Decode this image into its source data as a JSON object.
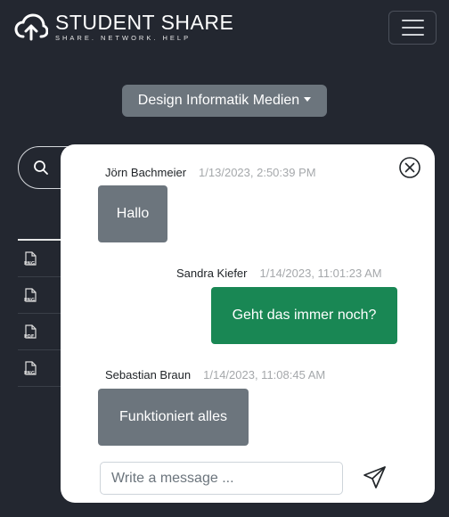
{
  "brand": {
    "title": "STUDENT SHARE",
    "tagline": "SHARE. NETWORK. HELP"
  },
  "department_dropdown": {
    "selected": "Design Informatik Medien"
  },
  "files": [
    {
      "ext": "PNG",
      "icon": "file-icon"
    },
    {
      "ext": "PNG",
      "icon": "file-icon"
    },
    {
      "ext": "PDF",
      "icon": "file-icon"
    },
    {
      "ext": "PNG",
      "icon": "file-icon"
    }
  ],
  "chat": {
    "messages": [
      {
        "author": "Jörn Bachmeier",
        "timestamp": "1/13/2023, 2:50:39 PM",
        "text": "Hallo",
        "own": false
      },
      {
        "author": "Sandra Kiefer",
        "timestamp": "1/14/2023, 11:01:23 AM",
        "text": "Geht das immer noch?",
        "own": true
      },
      {
        "author": "Sebastian Braun",
        "timestamp": "1/14/2023, 11:08:45 AM",
        "text": "Funktioniert alles",
        "own": false
      }
    ],
    "input": {
      "placeholder": "Write a message ...",
      "value": ""
    }
  },
  "colors": {
    "background": "#232730",
    "own_bubble": "#198754",
    "other_bubble": "#6c757d",
    "dropdown": "#6c757d"
  }
}
